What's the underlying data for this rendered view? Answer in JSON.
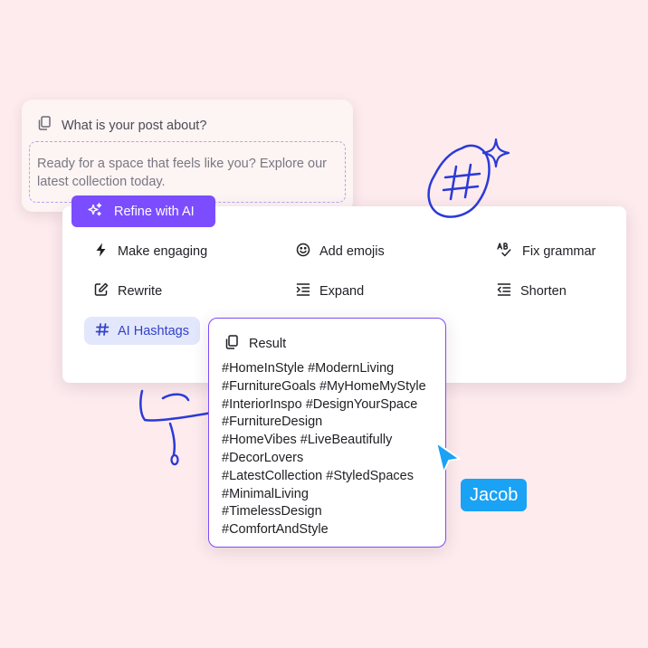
{
  "post": {
    "header_label": "What is your post about?",
    "text": "Ready for a space that feels like you? Explore our latest collection today."
  },
  "refine": {
    "label": "Refine with AI"
  },
  "menu": {
    "make_engaging": "Make engaging",
    "add_emojis": "Add emojis",
    "fix_grammar": "Fix grammar",
    "rewrite": "Rewrite",
    "expand": "Expand",
    "shorten": "Shorten",
    "ai_hashtags": "AI Hashtags"
  },
  "result": {
    "title": "Result",
    "lines": [
      "#HomeInStyle #ModernLiving",
      "#FurnitureGoals #MyHomeMyStyle",
      "#InteriorInspo #DesignYourSpace",
      "#FurnitureDesign",
      "#HomeVibes #LiveBeautifully",
      "#DecorLovers",
      "#LatestCollection #StyledSpaces",
      "#MinimalLiving",
      "#TimelessDesign",
      "#ComfortAndStyle"
    ]
  },
  "cursor": {
    "name": "Jacob"
  },
  "colors": {
    "background": "#fdebee",
    "accent": "#7c4dff",
    "hashtag_pill": "#e3e7fb",
    "doodle": "#2b3ad6",
    "cursor": "#1aa2f5"
  },
  "icons": [
    "copy-icon",
    "sparkles-icon",
    "lightning-icon",
    "smiley-icon",
    "spellcheck-icon",
    "edit-icon",
    "expand-icon",
    "shorten-icon",
    "hashtag-icon",
    "result-copy-icon",
    "cursor-arrow-icon"
  ]
}
